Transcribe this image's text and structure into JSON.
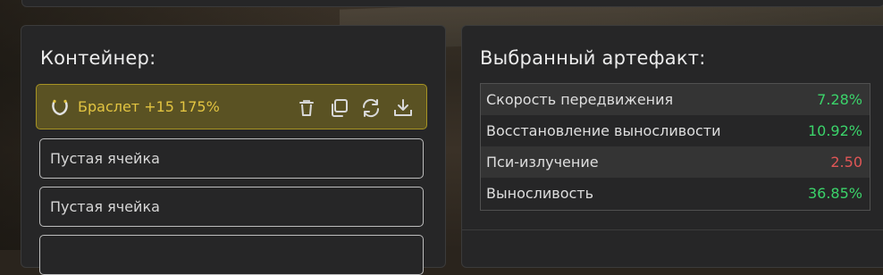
{
  "container": {
    "title": "Контейнер:",
    "selected_item": {
      "name": "Браслет +15 175%",
      "icon": "horseshoe-icon",
      "actions": [
        {
          "id": "delete",
          "icon": "trash-icon"
        },
        {
          "id": "duplicate",
          "icon": "copy-icon"
        },
        {
          "id": "swap",
          "icon": "refresh-icon"
        },
        {
          "id": "export",
          "icon": "download-icon"
        }
      ]
    },
    "empty_slots": [
      "Пустая ячейка",
      "Пустая ячейка",
      ""
    ]
  },
  "artifact": {
    "title": "Выбранный артефакт:",
    "stats": [
      {
        "label": "Скорость передвижения",
        "value": "7.28%",
        "tone": "positive"
      },
      {
        "label": "Восстановление выносливости",
        "value": "10.92%",
        "tone": "positive"
      },
      {
        "label": "Пси-излучение",
        "value": "2.50",
        "tone": "negative"
      },
      {
        "label": "Выносливость",
        "value": "36.85%",
        "tone": "positive"
      }
    ]
  },
  "colors": {
    "selected_bg": "#5a5223",
    "selected_border": "#a69323",
    "selected_text": "#e2c441",
    "positive": "#3bd36a",
    "negative": "#e05656"
  }
}
